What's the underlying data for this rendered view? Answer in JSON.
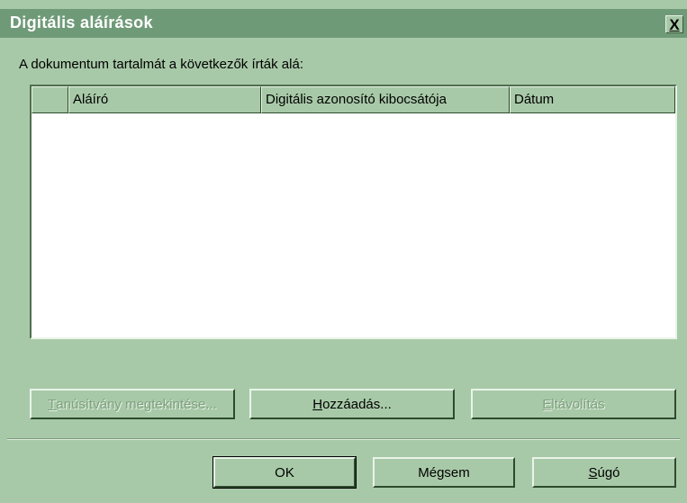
{
  "dialog": {
    "title": "Digitális aláírások",
    "close_label": "X"
  },
  "prompt": "A dokumentum tartalmát a következők írták alá:",
  "table": {
    "columns": [
      "",
      "Aláíró",
      "Digitális azonosító kibocsátója",
      "Dátum"
    ],
    "rows": []
  },
  "buttons": {
    "view_certificate": {
      "accel": "T",
      "rest": "anúsítvány megtekintése..."
    },
    "add": {
      "accel": "H",
      "rest": "ozzáadás..."
    },
    "remove": {
      "accel": "E",
      "rest": "ltávolítás"
    },
    "ok": "OK",
    "cancel": "Mégsem",
    "help": {
      "accel": "S",
      "rest": "úgó"
    }
  },
  "colors": {
    "dialog_bg": "#a8c9a8",
    "titlebar_bg": "#6f9a78",
    "list_bg": "#ffffff"
  }
}
